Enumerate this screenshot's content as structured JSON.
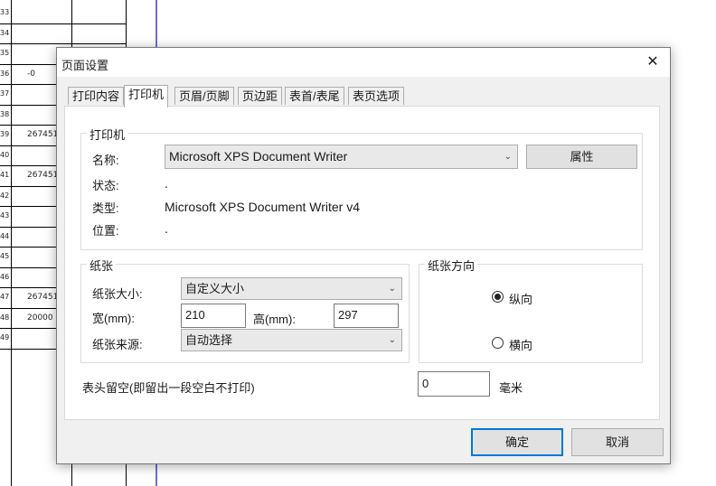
{
  "spreadsheet": {
    "row_numbers": [
      "33",
      "34",
      "35",
      "36",
      "37",
      "38",
      "39",
      "40",
      "41",
      "42",
      "43",
      "44",
      "45",
      "46",
      "47",
      "48",
      "49"
    ],
    "cells": [
      {
        "row": "36",
        "text": "-0"
      },
      {
        "row": "39",
        "text": "267451"
      },
      {
        "row": "41",
        "text": "267451"
      },
      {
        "row": "47",
        "text": "267451"
      },
      {
        "row": "48",
        "text": "20000"
      }
    ]
  },
  "dialog": {
    "title": "页面设置",
    "close_glyph": "✕",
    "tabs": [
      "打印内容",
      "打印机",
      "页眉/页脚",
      "页边距",
      "表首/表尾",
      "表页选项"
    ],
    "active_tab": "打印机",
    "printer_group": {
      "label": "打印机",
      "name_label": "名称:",
      "name_value": "Microsoft XPS Document Writer",
      "properties_button": "属性",
      "status_label": "状态:",
      "status_value": ".",
      "type_label": "类型:",
      "type_value": "Microsoft XPS Document Writer v4",
      "location_label": "位置:",
      "location_value": "."
    },
    "paper_group": {
      "label": "纸张",
      "size_label": "纸张大小:",
      "size_value": "自定义大小",
      "width_label": "宽(mm):",
      "width_value": "210",
      "height_label": "高(mm):",
      "height_value": "297",
      "source_label": "纸张来源:",
      "source_value": "自动选择"
    },
    "orientation_group": {
      "label": "纸张方向",
      "portrait_label": "纵向",
      "landscape_label": "横向",
      "selected": "纵向"
    },
    "header_reserve": {
      "label": "表头留空(即留出一段空白不打印)",
      "value": "0",
      "unit": "毫米"
    },
    "ok_button": "确定",
    "cancel_button": "取消"
  }
}
